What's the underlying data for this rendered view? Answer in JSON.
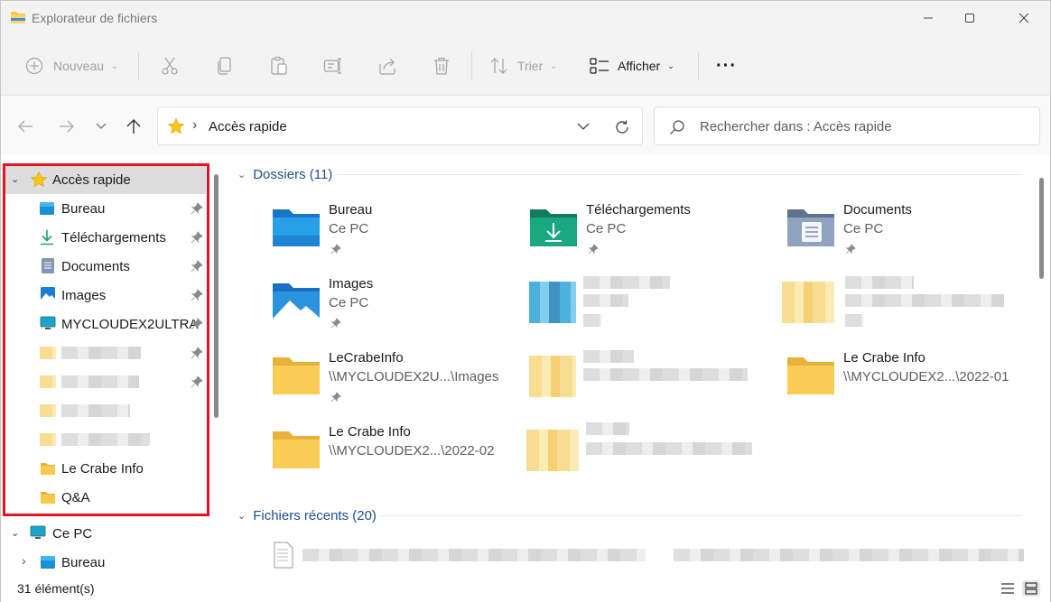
{
  "window": {
    "title": "Explorateur de fichiers"
  },
  "toolbar": {
    "new_label": "Nouveau",
    "sort_label": "Trier",
    "view_label": "Afficher",
    "more_label": "···"
  },
  "address": {
    "separator": "›",
    "location": "Accès rapide"
  },
  "search": {
    "placeholder": "Rechercher dans : Accès rapide"
  },
  "sidebar": {
    "quick_access": "Accès rapide",
    "items": [
      {
        "label": "Bureau",
        "icon": "desktop-icon",
        "pinned": true
      },
      {
        "label": "Téléchargements",
        "icon": "download-icon",
        "pinned": true
      },
      {
        "label": "Documents",
        "icon": "documents-icon",
        "pinned": true
      },
      {
        "label": "Images",
        "icon": "images-icon",
        "pinned": true
      },
      {
        "label": "MYCLOUDEX2ULTRA",
        "icon": "monitor-icon",
        "pinned": true
      }
    ],
    "folder_items": [
      {
        "label": "Le Crabe Info",
        "icon": "folder-icon"
      },
      {
        "label": "Q&A",
        "icon": "folder-icon"
      }
    ],
    "this_pc": "Ce PC",
    "this_pc_child": "Bureau"
  },
  "content": {
    "folders_header": "Dossiers (11)",
    "recent_header": "Fichiers récents (20)",
    "folders": [
      {
        "name": "Bureau",
        "sub": "Ce PC",
        "icon": "desktop-folder-icon"
      },
      {
        "name": "Téléchargements",
        "sub": "Ce PC",
        "icon": "downloads-folder-icon"
      },
      {
        "name": "Documents",
        "sub": "Ce PC",
        "icon": "documents-folder-icon"
      },
      {
        "name": "Images",
        "sub": "Ce PC",
        "icon": "images-folder-icon"
      },
      {
        "name": "LeCrabeInfo",
        "sub": "\\\\MYCLOUDEX2U...\\Images",
        "icon": "folder-icon"
      },
      {
        "name": "Le Crabe Info",
        "sub": "\\\\MYCLOUDEX2...\\2022-01",
        "icon": "folder-icon"
      },
      {
        "name": "Le Crabe Info",
        "sub": "\\\\MYCLOUDEX2...\\2022-02",
        "icon": "folder-icon"
      }
    ]
  },
  "status": {
    "count": "31 élément(s)"
  },
  "colors": {
    "accent": "#1f4e8c",
    "highlight": "#e81123",
    "folder": "#f8c94a"
  }
}
